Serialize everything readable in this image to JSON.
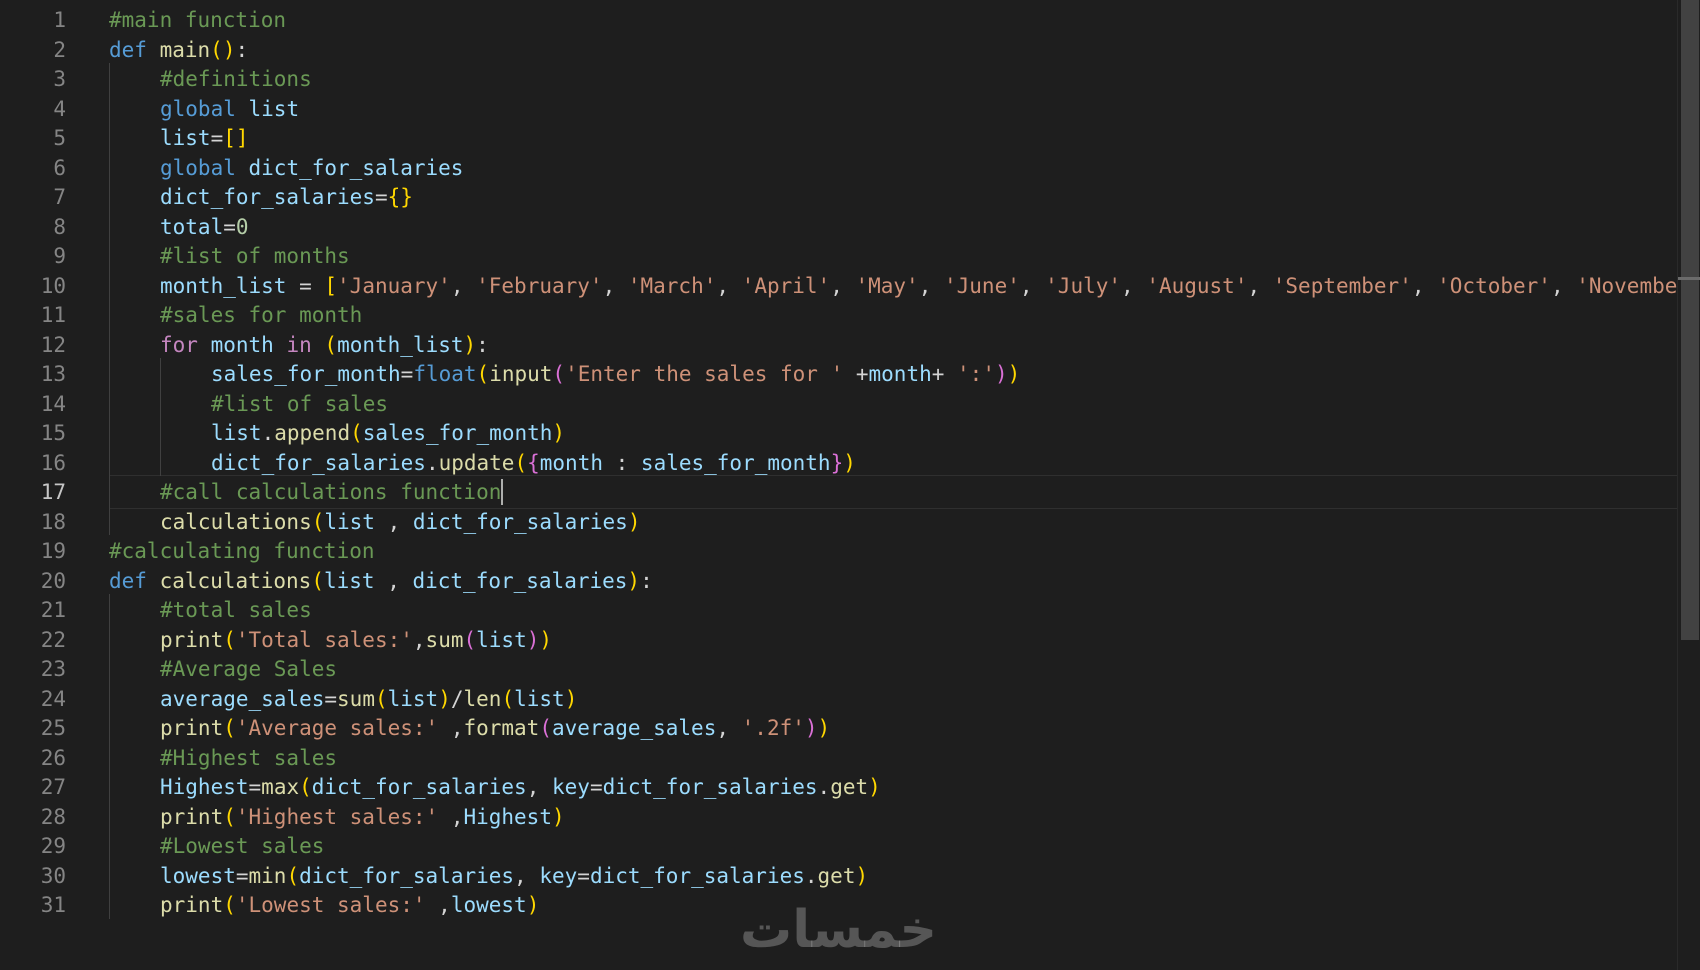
{
  "editor": {
    "active_line": 17,
    "watermark": "خمسات",
    "lines": [
      {
        "n": "1",
        "indent": 0,
        "tokens": [
          {
            "t": "#main function",
            "c": "cmt"
          }
        ]
      },
      {
        "n": "2",
        "indent": 0,
        "tokens": [
          {
            "t": "def",
            "c": "kw"
          },
          {
            "t": " ",
            "c": "op"
          },
          {
            "t": "main",
            "c": "fn"
          },
          {
            "t": "(",
            "c": "b1"
          },
          {
            "t": ")",
            "c": "b1"
          },
          {
            "t": ":",
            "c": "op"
          }
        ]
      },
      {
        "n": "3",
        "indent": 1,
        "tokens": [
          {
            "t": "#definitions",
            "c": "cmt"
          }
        ]
      },
      {
        "n": "4",
        "indent": 1,
        "tokens": [
          {
            "t": "global",
            "c": "kw"
          },
          {
            "t": " ",
            "c": "op"
          },
          {
            "t": "list",
            "c": "var"
          }
        ]
      },
      {
        "n": "5",
        "indent": 1,
        "tokens": [
          {
            "t": "list",
            "c": "var"
          },
          {
            "t": "=",
            "c": "op"
          },
          {
            "t": "[]",
            "c": "b1"
          }
        ]
      },
      {
        "n": "6",
        "indent": 1,
        "tokens": [
          {
            "t": "global",
            "c": "kw"
          },
          {
            "t": " ",
            "c": "op"
          },
          {
            "t": "dict_for_salaries",
            "c": "var"
          }
        ]
      },
      {
        "n": "7",
        "indent": 1,
        "tokens": [
          {
            "t": "dict_for_salaries",
            "c": "var"
          },
          {
            "t": "=",
            "c": "op"
          },
          {
            "t": "{}",
            "c": "b1"
          }
        ]
      },
      {
        "n": "8",
        "indent": 1,
        "tokens": [
          {
            "t": "total",
            "c": "var"
          },
          {
            "t": "=",
            "c": "op"
          },
          {
            "t": "0",
            "c": "num"
          }
        ]
      },
      {
        "n": "9",
        "indent": 1,
        "tokens": [
          {
            "t": "#list of months",
            "c": "cmt"
          }
        ]
      },
      {
        "n": "10",
        "indent": 1,
        "tokens": [
          {
            "t": "month_list",
            "c": "var"
          },
          {
            "t": " = ",
            "c": "op"
          },
          {
            "t": "[",
            "c": "b1"
          },
          {
            "t": "'January'",
            "c": "str"
          },
          {
            "t": ", ",
            "c": "op"
          },
          {
            "t": "'February'",
            "c": "str"
          },
          {
            "t": ", ",
            "c": "op"
          },
          {
            "t": "'March'",
            "c": "str"
          },
          {
            "t": ", ",
            "c": "op"
          },
          {
            "t": "'April'",
            "c": "str"
          },
          {
            "t": ", ",
            "c": "op"
          },
          {
            "t": "'May'",
            "c": "str"
          },
          {
            "t": ", ",
            "c": "op"
          },
          {
            "t": "'June'",
            "c": "str"
          },
          {
            "t": ", ",
            "c": "op"
          },
          {
            "t": "'July'",
            "c": "str"
          },
          {
            "t": ", ",
            "c": "op"
          },
          {
            "t": "'August'",
            "c": "str"
          },
          {
            "t": ", ",
            "c": "op"
          },
          {
            "t": "'September'",
            "c": "str"
          },
          {
            "t": ", ",
            "c": "op"
          },
          {
            "t": "'October'",
            "c": "str"
          },
          {
            "t": ", ",
            "c": "op"
          },
          {
            "t": "'Novembe",
            "c": "str"
          }
        ]
      },
      {
        "n": "11",
        "indent": 1,
        "tokens": [
          {
            "t": "#sales for month",
            "c": "cmt"
          }
        ]
      },
      {
        "n": "12",
        "indent": 1,
        "tokens": [
          {
            "t": "for",
            "c": "ctrl"
          },
          {
            "t": " ",
            "c": "op"
          },
          {
            "t": "month",
            "c": "var"
          },
          {
            "t": " ",
            "c": "op"
          },
          {
            "t": "in",
            "c": "ctrl"
          },
          {
            "t": " ",
            "c": "op"
          },
          {
            "t": "(",
            "c": "b1"
          },
          {
            "t": "month_list",
            "c": "var"
          },
          {
            "t": ")",
            "c": "b1"
          },
          {
            "t": ":",
            "c": "op"
          }
        ]
      },
      {
        "n": "13",
        "indent": 2,
        "tokens": [
          {
            "t": "sales_for_month",
            "c": "var"
          },
          {
            "t": "=",
            "c": "op"
          },
          {
            "t": "float",
            "c": "kw"
          },
          {
            "t": "(",
            "c": "b1"
          },
          {
            "t": "input",
            "c": "fn"
          },
          {
            "t": "(",
            "c": "b2"
          },
          {
            "t": "'Enter the sales for '",
            "c": "str"
          },
          {
            "t": " +",
            "c": "op"
          },
          {
            "t": "month",
            "c": "var"
          },
          {
            "t": "+ ",
            "c": "op"
          },
          {
            "t": "':'",
            "c": "str"
          },
          {
            "t": ")",
            "c": "b2"
          },
          {
            "t": ")",
            "c": "b1"
          }
        ]
      },
      {
        "n": "14",
        "indent": 2,
        "tokens": [
          {
            "t": "#list of sales",
            "c": "cmt"
          }
        ]
      },
      {
        "n": "15",
        "indent": 2,
        "tokens": [
          {
            "t": "list",
            "c": "var"
          },
          {
            "t": ".",
            "c": "op"
          },
          {
            "t": "append",
            "c": "fn"
          },
          {
            "t": "(",
            "c": "b1"
          },
          {
            "t": "sales_for_month",
            "c": "var"
          },
          {
            "t": ")",
            "c": "b1"
          }
        ]
      },
      {
        "n": "16",
        "indent": 2,
        "tokens": [
          {
            "t": "dict_for_salaries",
            "c": "var"
          },
          {
            "t": ".",
            "c": "op"
          },
          {
            "t": "update",
            "c": "fn"
          },
          {
            "t": "(",
            "c": "b1"
          },
          {
            "t": "{",
            "c": "b2"
          },
          {
            "t": "month",
            "c": "var"
          },
          {
            "t": " : ",
            "c": "op"
          },
          {
            "t": "sales_for_month",
            "c": "var"
          },
          {
            "t": "}",
            "c": "b2"
          },
          {
            "t": ")",
            "c": "b1"
          }
        ]
      },
      {
        "n": "17",
        "indent": 1,
        "tokens": [
          {
            "t": "#call calculations function",
            "c": "cmt"
          }
        ]
      },
      {
        "n": "18",
        "indent": 1,
        "tokens": [
          {
            "t": "calculations",
            "c": "fn"
          },
          {
            "t": "(",
            "c": "b1"
          },
          {
            "t": "list",
            "c": "var"
          },
          {
            "t": " , ",
            "c": "op"
          },
          {
            "t": "dict_for_salaries",
            "c": "var"
          },
          {
            "t": ")",
            "c": "b1"
          }
        ]
      },
      {
        "n": "19",
        "indent": 0,
        "tokens": [
          {
            "t": "#calculating function",
            "c": "cmt"
          }
        ]
      },
      {
        "n": "20",
        "indent": 0,
        "tokens": [
          {
            "t": "def",
            "c": "kw"
          },
          {
            "t": " ",
            "c": "op"
          },
          {
            "t": "calculations",
            "c": "fn"
          },
          {
            "t": "(",
            "c": "b1"
          },
          {
            "t": "list",
            "c": "var"
          },
          {
            "t": " , ",
            "c": "op"
          },
          {
            "t": "dict_for_salaries",
            "c": "var"
          },
          {
            "t": ")",
            "c": "b1"
          },
          {
            "t": ":",
            "c": "op"
          }
        ]
      },
      {
        "n": "21",
        "indent": 1,
        "tokens": [
          {
            "t": "#total sales",
            "c": "cmt"
          }
        ]
      },
      {
        "n": "22",
        "indent": 1,
        "tokens": [
          {
            "t": "print",
            "c": "fn"
          },
          {
            "t": "(",
            "c": "b1"
          },
          {
            "t": "'Total sales:'",
            "c": "str"
          },
          {
            "t": ",",
            "c": "op"
          },
          {
            "t": "sum",
            "c": "fn"
          },
          {
            "t": "(",
            "c": "b2"
          },
          {
            "t": "list",
            "c": "var"
          },
          {
            "t": ")",
            "c": "b2"
          },
          {
            "t": ")",
            "c": "b1"
          }
        ]
      },
      {
        "n": "23",
        "indent": 1,
        "tokens": [
          {
            "t": "#Average Sales",
            "c": "cmt"
          }
        ]
      },
      {
        "n": "24",
        "indent": 1,
        "tokens": [
          {
            "t": "average_sales",
            "c": "var"
          },
          {
            "t": "=",
            "c": "op"
          },
          {
            "t": "sum",
            "c": "fn"
          },
          {
            "t": "(",
            "c": "b1"
          },
          {
            "t": "list",
            "c": "var"
          },
          {
            "t": ")",
            "c": "b1"
          },
          {
            "t": "/",
            "c": "op"
          },
          {
            "t": "len",
            "c": "fn"
          },
          {
            "t": "(",
            "c": "b1"
          },
          {
            "t": "list",
            "c": "var"
          },
          {
            "t": ")",
            "c": "b1"
          }
        ]
      },
      {
        "n": "25",
        "indent": 1,
        "tokens": [
          {
            "t": "print",
            "c": "fn"
          },
          {
            "t": "(",
            "c": "b1"
          },
          {
            "t": "'Average sales:'",
            "c": "str"
          },
          {
            "t": " ,",
            "c": "op"
          },
          {
            "t": "format",
            "c": "fn"
          },
          {
            "t": "(",
            "c": "b2"
          },
          {
            "t": "average_sales",
            "c": "var"
          },
          {
            "t": ", ",
            "c": "op"
          },
          {
            "t": "'.2f'",
            "c": "str"
          },
          {
            "t": ")",
            "c": "b2"
          },
          {
            "t": ")",
            "c": "b1"
          }
        ]
      },
      {
        "n": "26",
        "indent": 1,
        "tokens": [
          {
            "t": "#Highest sales",
            "c": "cmt"
          }
        ]
      },
      {
        "n": "27",
        "indent": 1,
        "tokens": [
          {
            "t": "Highest",
            "c": "var"
          },
          {
            "t": "=",
            "c": "op"
          },
          {
            "t": "max",
            "c": "fn"
          },
          {
            "t": "(",
            "c": "b1"
          },
          {
            "t": "dict_for_salaries",
            "c": "var"
          },
          {
            "t": ", ",
            "c": "op"
          },
          {
            "t": "key",
            "c": "var"
          },
          {
            "t": "=",
            "c": "op"
          },
          {
            "t": "dict_for_salaries",
            "c": "var"
          },
          {
            "t": ".",
            "c": "op"
          },
          {
            "t": "get",
            "c": "fn"
          },
          {
            "t": ")",
            "c": "b1"
          }
        ]
      },
      {
        "n": "28",
        "indent": 1,
        "tokens": [
          {
            "t": "print",
            "c": "fn"
          },
          {
            "t": "(",
            "c": "b1"
          },
          {
            "t": "'Highest sales:'",
            "c": "str"
          },
          {
            "t": " ,",
            "c": "op"
          },
          {
            "t": "Highest",
            "c": "var"
          },
          {
            "t": ")",
            "c": "b1"
          }
        ]
      },
      {
        "n": "29",
        "indent": 1,
        "tokens": [
          {
            "t": "#Lowest sales",
            "c": "cmt"
          }
        ]
      },
      {
        "n": "30",
        "indent": 1,
        "tokens": [
          {
            "t": "lowest",
            "c": "var"
          },
          {
            "t": "=",
            "c": "op"
          },
          {
            "t": "min",
            "c": "fn"
          },
          {
            "t": "(",
            "c": "b1"
          },
          {
            "t": "dict_for_salaries",
            "c": "var"
          },
          {
            "t": ", ",
            "c": "op"
          },
          {
            "t": "key",
            "c": "var"
          },
          {
            "t": "=",
            "c": "op"
          },
          {
            "t": "dict_for_salaries",
            "c": "var"
          },
          {
            "t": ".",
            "c": "op"
          },
          {
            "t": "get",
            "c": "fn"
          },
          {
            "t": ")",
            "c": "b1"
          }
        ]
      },
      {
        "n": "31",
        "indent": 1,
        "tokens": [
          {
            "t": "print",
            "c": "fn"
          },
          {
            "t": "(",
            "c": "b1"
          },
          {
            "t": "'Lowest sales:'",
            "c": "str"
          },
          {
            "t": " ,",
            "c": "op"
          },
          {
            "t": "lowest",
            "c": "var"
          },
          {
            "t": ")",
            "c": "b1"
          }
        ]
      }
    ]
  }
}
